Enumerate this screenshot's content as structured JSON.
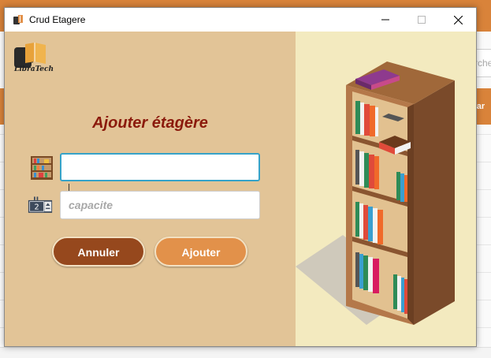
{
  "background": {
    "search_fragment": "rche",
    "column_fragment": "star"
  },
  "window": {
    "title": "Crud Etagere",
    "controls": {
      "minimize": "minimize-icon",
      "maximize": "maximize-icon",
      "close": "close-icon"
    }
  },
  "form": {
    "logo_text": "LibraTech",
    "heading": "Ajouter étagère",
    "shelf_field": {
      "value": "",
      "placeholder": ""
    },
    "capacity_field": {
      "value": "",
      "placeholder": "capacite"
    },
    "cancel_label": "Annuler",
    "submit_label": "Ajouter"
  },
  "colors": {
    "left_panel": "#e2c497",
    "right_panel": "#f3eabf",
    "heading": "#8b1a0c",
    "cancel_button": "#96481d",
    "submit_button": "#e2914a",
    "focus_border": "#36a3c9"
  }
}
